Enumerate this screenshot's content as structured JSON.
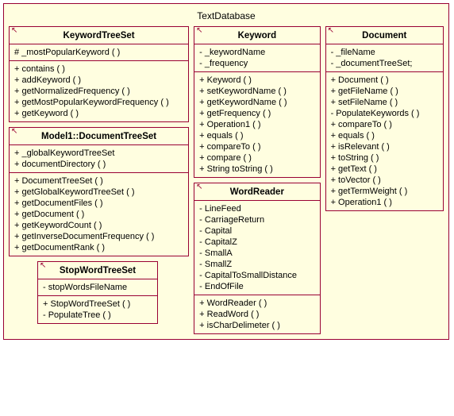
{
  "package": {
    "title": "TextDatabase"
  },
  "classes": {
    "keywordTreeSet": {
      "name": "KeywordTreeSet",
      "attrs": [
        "#  _mostPopularKeyword (   )"
      ],
      "ops": [
        "+ contains (   )",
        "+ addKeyword (   )",
        "+ getNormalizedFrequency (   )",
        "+ getMostPopularKeywordFrequency (   )",
        "+ getKeyword (   )"
      ]
    },
    "documentTreeSet": {
      "name": "Model1::DocumentTreeSet",
      "attrs": [
        "+ _globalKeywordTreeSet",
        "+ documentDirectory (   )"
      ],
      "ops": [
        "+ DocumentTreeSet (   )",
        "+ getGlobalKeywordTreeSet (   )",
        "+ getDocumentFiles (   )",
        "+ getDocument (   )",
        "+ getKeywordCount (   )",
        "+ getInverseDocumentFrequency (   )",
        "+ getDocumentRank (   )"
      ]
    },
    "stopWordTreeSet": {
      "name": "StopWordTreeSet",
      "attrs": [
        "- stopWordsFileName"
      ],
      "ops": [
        "+ StopWordTreeSet (   )",
        "- PopulateTree (   )"
      ]
    },
    "keyword": {
      "name": "Keyword",
      "attrs": [
        "-  _keywordName",
        "-  _frequency"
      ],
      "ops": [
        "+ Keyword (   )",
        "+ setKeywordName (   )",
        "+ getKeywordName (   )",
        "+ getFrequency (   )",
        "+ Operation1 (   )",
        "+ equals (   )",
        "+ compareTo (   )",
        "+ compare (   )",
        "+ String toString (   )"
      ]
    },
    "wordReader": {
      "name": "WordReader",
      "attrs": [
        "- LineFeed",
        "- CarriageReturn",
        "- Capital",
        "- CapitalZ",
        "- SmallA",
        "- SmallZ",
        "- CapitalToSmallDistance",
        "- EndOfFile"
      ],
      "ops": [
        "+ WordReader (   )",
        "+ ReadWord (   )",
        "+ isCharDelimeter (   )"
      ]
    },
    "document": {
      "name": "Document",
      "attrs": [
        "-  _fileName",
        "-  _documentTreeSet;"
      ],
      "ops": [
        "+ Document (   )",
        "+ getFileName (   )",
        "+ setFileName (   )",
        "- PopulateKeywords (   )",
        "+ compareTo (   )",
        "+ equals (   )",
        "+ isRelevant (   )",
        "+ toString (   )",
        "+ getText (   )",
        "+ toVector (   )",
        "+ getTermWeight (   )",
        "+ Operation1 (   )"
      ]
    }
  },
  "chart_data": {
    "type": "table",
    "title": "UML Class Diagram — package TextDatabase",
    "classes": [
      {
        "name": "KeywordTreeSet",
        "attributes": [
          {
            "visibility": "#",
            "name": "_mostPopularKeyword",
            "isOperationLike": true
          }
        ],
        "operations": [
          {
            "visibility": "+",
            "name": "contains"
          },
          {
            "visibility": "+",
            "name": "addKeyword"
          },
          {
            "visibility": "+",
            "name": "getNormalizedFrequency"
          },
          {
            "visibility": "+",
            "name": "getMostPopularKeywordFrequency"
          },
          {
            "visibility": "+",
            "name": "getKeyword"
          }
        ]
      },
      {
        "name": "Model1::DocumentTreeSet",
        "attributes": [
          {
            "visibility": "+",
            "name": "_globalKeywordTreeSet"
          },
          {
            "visibility": "+",
            "name": "documentDirectory",
            "isOperationLike": true
          }
        ],
        "operations": [
          {
            "visibility": "+",
            "name": "DocumentTreeSet"
          },
          {
            "visibility": "+",
            "name": "getGlobalKeywordTreeSet"
          },
          {
            "visibility": "+",
            "name": "getDocumentFiles"
          },
          {
            "visibility": "+",
            "name": "getDocument"
          },
          {
            "visibility": "+",
            "name": "getKeywordCount"
          },
          {
            "visibility": "+",
            "name": "getInverseDocumentFrequency"
          },
          {
            "visibility": "+",
            "name": "getDocumentRank"
          }
        ]
      },
      {
        "name": "StopWordTreeSet",
        "attributes": [
          {
            "visibility": "-",
            "name": "stopWordsFileName"
          }
        ],
        "operations": [
          {
            "visibility": "+",
            "name": "StopWordTreeSet"
          },
          {
            "visibility": "-",
            "name": "PopulateTree"
          }
        ]
      },
      {
        "name": "Keyword",
        "attributes": [
          {
            "visibility": "-",
            "name": "_keywordName"
          },
          {
            "visibility": "-",
            "name": "_frequency"
          }
        ],
        "operations": [
          {
            "visibility": "+",
            "name": "Keyword"
          },
          {
            "visibility": "+",
            "name": "setKeywordName"
          },
          {
            "visibility": "+",
            "name": "getKeywordName"
          },
          {
            "visibility": "+",
            "name": "getFrequency"
          },
          {
            "visibility": "+",
            "name": "Operation1"
          },
          {
            "visibility": "+",
            "name": "equals"
          },
          {
            "visibility": "+",
            "name": "compareTo"
          },
          {
            "visibility": "+",
            "name": "compare"
          },
          {
            "visibility": "+",
            "name": "String toString"
          }
        ]
      },
      {
        "name": "WordReader",
        "attributes": [
          {
            "visibility": "-",
            "name": "LineFeed"
          },
          {
            "visibility": "-",
            "name": "CarriageReturn"
          },
          {
            "visibility": "-",
            "name": "Capital"
          },
          {
            "visibility": "-",
            "name": "CapitalZ"
          },
          {
            "visibility": "-",
            "name": "SmallA"
          },
          {
            "visibility": "-",
            "name": "SmallZ"
          },
          {
            "visibility": "-",
            "name": "CapitalToSmallDistance"
          },
          {
            "visibility": "-",
            "name": "EndOfFile"
          }
        ],
        "operations": [
          {
            "visibility": "+",
            "name": "WordReader"
          },
          {
            "visibility": "+",
            "name": "ReadWord"
          },
          {
            "visibility": "+",
            "name": "isCharDelimeter"
          }
        ]
      },
      {
        "name": "Document",
        "attributes": [
          {
            "visibility": "-",
            "name": "_fileName"
          },
          {
            "visibility": "-",
            "name": "_documentTreeSet;"
          }
        ],
        "operations": [
          {
            "visibility": "+",
            "name": "Document"
          },
          {
            "visibility": "+",
            "name": "getFileName"
          },
          {
            "visibility": "+",
            "name": "setFileName"
          },
          {
            "visibility": "-",
            "name": "PopulateKeywords"
          },
          {
            "visibility": "+",
            "name": "compareTo"
          },
          {
            "visibility": "+",
            "name": "equals"
          },
          {
            "visibility": "+",
            "name": "isRelevant"
          },
          {
            "visibility": "+",
            "name": "toString"
          },
          {
            "visibility": "+",
            "name": "getText"
          },
          {
            "visibility": "+",
            "name": "toVector"
          },
          {
            "visibility": "+",
            "name": "getTermWeight"
          },
          {
            "visibility": "+",
            "name": "Operation1"
          }
        ]
      }
    ]
  }
}
